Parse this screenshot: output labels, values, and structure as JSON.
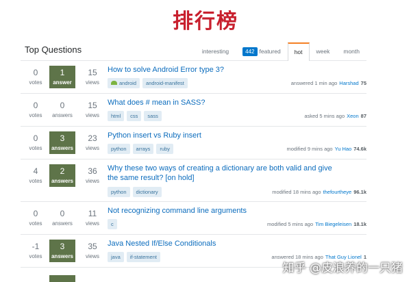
{
  "banner": {
    "title": "排行榜"
  },
  "header": {
    "title": "Top Questions",
    "tabs": [
      {
        "label": "interesting",
        "count": ""
      },
      {
        "label": "featured",
        "count": "442"
      },
      {
        "label": "hot",
        "count": "",
        "active": true
      },
      {
        "label": "week",
        "count": ""
      },
      {
        "label": "month",
        "count": ""
      }
    ]
  },
  "questions": [
    {
      "votes": "0",
      "votes_label": "votes",
      "answers": "1",
      "answers_label": "answer",
      "accepted": true,
      "views": "15",
      "views_label": "views",
      "title": "How to solve Android Error type 3?",
      "tags": [
        "android",
        "android-manifest"
      ],
      "action": "answered 1 min ago",
      "user": "Harshad",
      "rep": "75"
    },
    {
      "votes": "0",
      "votes_label": "votes",
      "answers": "0",
      "answers_label": "answers",
      "accepted": false,
      "views": "15",
      "views_label": "views",
      "title": "What does # mean in SASS?",
      "tags": [
        "html",
        "css",
        "sass"
      ],
      "action": "asked 5 mins ago",
      "user": "Xeon",
      "rep": "87"
    },
    {
      "votes": "0",
      "votes_label": "votes",
      "answers": "3",
      "answers_label": "answers",
      "accepted": true,
      "views": "23",
      "views_label": "views",
      "title": "Python insert vs Ruby insert",
      "tags": [
        "python",
        "arrays",
        "ruby"
      ],
      "action": "modified 9 mins ago",
      "user": "Yu Hao",
      "rep": "74.6k"
    },
    {
      "votes": "4",
      "votes_label": "votes",
      "answers": "2",
      "answers_label": "answers",
      "accepted": true,
      "views": "36",
      "views_label": "views",
      "title": "Why these two ways of creating a dictionary are both valid and give the same result? [on hold]",
      "tags": [
        "python",
        "dictionary"
      ],
      "action": "modified 18 mins ago",
      "user": "thefourtheye",
      "rep": "96.1k"
    },
    {
      "votes": "0",
      "votes_label": "votes",
      "answers": "0",
      "answers_label": "answers",
      "accepted": false,
      "views": "11",
      "views_label": "views",
      "title": "Not recognizing command line arguments",
      "tags": [
        "c"
      ],
      "action": "modified 5 mins ago",
      "user": "Tim Biegeleisen",
      "rep": "18.1k"
    },
    {
      "votes": "-1",
      "votes_label": "votes",
      "answers": "3",
      "answers_label": "answers",
      "accepted": true,
      "views": "35",
      "views_label": "views",
      "title": "Java Nested If/Else Conditionals",
      "tags": [
        "java",
        "if-statement"
      ],
      "action": "answered 18 mins ago",
      "user": "That Guy Lionel",
      "rep": "1"
    }
  ],
  "watermark": "知乎 @皮浪养的一只猪",
  "colors": {
    "accepted": "#5e7449",
    "link": "#0b6cbd",
    "tab_accent": "#f48024",
    "featured_badge": "#0077cc",
    "banner": "#c8202e"
  }
}
